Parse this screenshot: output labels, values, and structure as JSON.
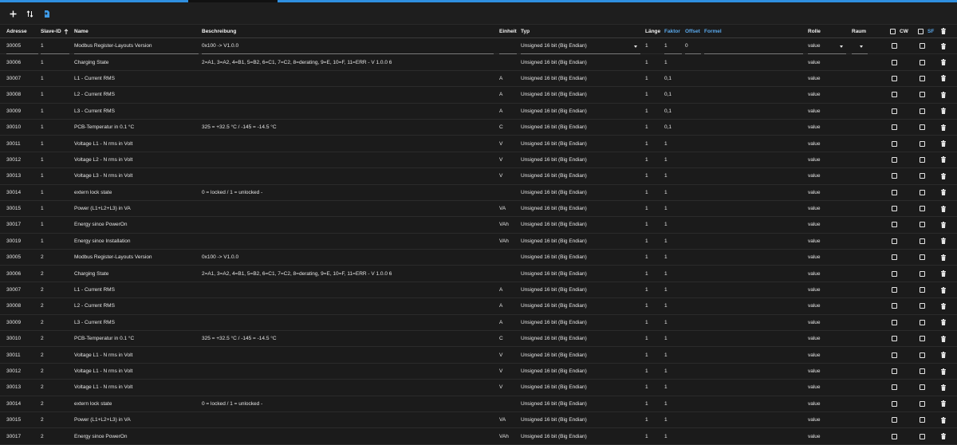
{
  "toolbar": {
    "add_icon": "plus-icon",
    "sort_icon": "sort-arrows-icon",
    "import_icon": "import-icon"
  },
  "columns": {
    "adresse": "Adresse",
    "slave": "Slave-ID",
    "name": "Name",
    "beschreibung": "Beschreibung",
    "einheit": "Einheit",
    "typ": "Typ",
    "laenge": "Länge",
    "faktor": "Faktor",
    "offset": "Offset",
    "formel": "Formel",
    "rolle": "Rolle",
    "raum": "Raum",
    "cw": "CW",
    "sf": "SF"
  },
  "rows": [
    {
      "addr": "30005",
      "slave": "1",
      "name": "Modbus Register-Layouts Version",
      "desc": "0x100 -> V1.0.0",
      "unit": "",
      "typ": "Unsigned 16 bit (Big Endian)",
      "len": "1",
      "fak": "1",
      "off": "0",
      "role": "value"
    },
    {
      "addr": "30006",
      "slave": "1",
      "name": "Charging State",
      "desc": "2=A1, 3=A2, 4=B1, 5=B2, 6=C1, 7=C2, 8=derating, 9=E, 10=F, 11=ERR - V 1.0.0 6",
      "unit": "",
      "typ": "Unsigned 16 bit (Big Endian)",
      "len": "1",
      "fak": "1",
      "off": "",
      "role": "value"
    },
    {
      "addr": "30007",
      "slave": "1",
      "name": "L1 - Current RMS",
      "desc": "",
      "unit": "A",
      "typ": "Unsigned 16 bit (Big Endian)",
      "len": "1",
      "fak": "0,1",
      "off": "",
      "role": "value"
    },
    {
      "addr": "30008",
      "slave": "1",
      "name": "L2 - Current RMS",
      "desc": "",
      "unit": "A",
      "typ": "Unsigned 16 bit (Big Endian)",
      "len": "1",
      "fak": "0,1",
      "off": "",
      "role": "value"
    },
    {
      "addr": "30009",
      "slave": "1",
      "name": "L3 - Current RMS",
      "desc": "",
      "unit": "A",
      "typ": "Unsigned 16 bit (Big Endian)",
      "len": "1",
      "fak": "0,1",
      "off": "",
      "role": "value"
    },
    {
      "addr": "30010",
      "slave": "1",
      "name": "PCB-Temperatur in 0.1 °C",
      "desc": "325 = +32.5 °C / -145 = -14.5 °C",
      "unit": "C",
      "typ": "Unsigned 16 bit (Big Endian)",
      "len": "1",
      "fak": "0,1",
      "off": "",
      "role": "value"
    },
    {
      "addr": "30011",
      "slave": "1",
      "name": "Voltage L1 - N rms in Volt",
      "desc": "",
      "unit": "V",
      "typ": "Unsigned 16 bit (Big Endian)",
      "len": "1",
      "fak": "1",
      "off": "",
      "role": "value"
    },
    {
      "addr": "30012",
      "slave": "1",
      "name": "Voltage L2 - N rms in Volt",
      "desc": "",
      "unit": "V",
      "typ": "Unsigned 16 bit (Big Endian)",
      "len": "1",
      "fak": "1",
      "off": "",
      "role": "value"
    },
    {
      "addr": "30013",
      "slave": "1",
      "name": "Voltage L3 - N rms in Volt",
      "desc": "",
      "unit": "V",
      "typ": "Unsigned 16 bit (Big Endian)",
      "len": "1",
      "fak": "1",
      "off": "",
      "role": "value"
    },
    {
      "addr": "30014",
      "slave": "1",
      "name": "extern lock state",
      "desc": "0 = locked / 1 = unlocked -",
      "unit": "",
      "typ": "Unsigned 16 bit (Big Endian)",
      "len": "1",
      "fak": "1",
      "off": "",
      "role": "value"
    },
    {
      "addr": "30015",
      "slave": "1",
      "name": "Power (L1+L2+L3) in VA",
      "desc": "",
      "unit": "VA",
      "typ": "Unsigned 16 bit (Big Endian)",
      "len": "1",
      "fak": "1",
      "off": "",
      "role": "value"
    },
    {
      "addr": "30017",
      "slave": "1",
      "name": "Energy since PowerOn",
      "desc": "",
      "unit": "VAh",
      "typ": "Unsigned 16 bit (Big Endian)",
      "len": "1",
      "fak": "1",
      "off": "",
      "role": "value"
    },
    {
      "addr": "30019",
      "slave": "1",
      "name": "Energy since Installation",
      "desc": "",
      "unit": "VAh",
      "typ": "Unsigned 16 bit (Big Endian)",
      "len": "1",
      "fak": "1",
      "off": "",
      "role": "value"
    },
    {
      "addr": "30005",
      "slave": "2",
      "name": "Modbus Register-Layouts Version",
      "desc": "0x100 -> V1.0.0",
      "unit": "",
      "typ": "Unsigned 16 bit (Big Endian)",
      "len": "1",
      "fak": "1",
      "off": "",
      "role": "value"
    },
    {
      "addr": "30006",
      "slave": "2",
      "name": "Charging State",
      "desc": "2=A1, 3=A2, 4=B1, 5=B2, 6=C1, 7=C2, 8=derating, 9=E, 10=F, 11=ERR - V 1.0.0 6",
      "unit": "",
      "typ": "Unsigned 16 bit (Big Endian)",
      "len": "1",
      "fak": "1",
      "off": "",
      "role": "value"
    },
    {
      "addr": "30007",
      "slave": "2",
      "name": "L1 - Current RMS",
      "desc": "",
      "unit": "A",
      "typ": "Unsigned 16 bit (Big Endian)",
      "len": "1",
      "fak": "1",
      "off": "",
      "role": "value"
    },
    {
      "addr": "30008",
      "slave": "2",
      "name": "L2 - Current RMS",
      "desc": "",
      "unit": "A",
      "typ": "Unsigned 16 bit (Big Endian)",
      "len": "1",
      "fak": "1",
      "off": "",
      "role": "value"
    },
    {
      "addr": "30009",
      "slave": "2",
      "name": "L3 - Current RMS",
      "desc": "",
      "unit": "A",
      "typ": "Unsigned 16 bit (Big Endian)",
      "len": "1",
      "fak": "1",
      "off": "",
      "role": "value"
    },
    {
      "addr": "30010",
      "slave": "2",
      "name": "PCB-Temperatur in 0.1 °C",
      "desc": "325 = +32.5 °C / -145 = -14.5 °C",
      "unit": "C",
      "typ": "Unsigned 16 bit (Big Endian)",
      "len": "1",
      "fak": "1",
      "off": "",
      "role": "value"
    },
    {
      "addr": "30011",
      "slave": "2",
      "name": "Voltage L1 - N rms in Volt",
      "desc": "",
      "unit": "V",
      "typ": "Unsigned 16 bit (Big Endian)",
      "len": "1",
      "fak": "1",
      "off": "",
      "role": "value"
    },
    {
      "addr": "30012",
      "slave": "2",
      "name": "Voltage L1 - N rms in Volt",
      "desc": "",
      "unit": "V",
      "typ": "Unsigned 16 bit (Big Endian)",
      "len": "1",
      "fak": "1",
      "off": "",
      "role": "value"
    },
    {
      "addr": "30013",
      "slave": "2",
      "name": "Voltage L1 - N rms in Volt",
      "desc": "",
      "unit": "V",
      "typ": "Unsigned 16 bit (Big Endian)",
      "len": "1",
      "fak": "1",
      "off": "",
      "role": "value"
    },
    {
      "addr": "30014",
      "slave": "2",
      "name": "extern lock state",
      "desc": "0 = locked / 1 = unlocked -",
      "unit": "",
      "typ": "Unsigned 16 bit (Big Endian)",
      "len": "1",
      "fak": "1",
      "off": "",
      "role": "value"
    },
    {
      "addr": "30015",
      "slave": "2",
      "name": "Power (L1+L2+L3) in VA",
      "desc": "",
      "unit": "VA",
      "typ": "Unsigned 16 bit (Big Endian)",
      "len": "1",
      "fak": "1",
      "off": "",
      "role": "value"
    },
    {
      "addr": "30017",
      "slave": "2",
      "name": "Energy since PowerOn",
      "desc": "",
      "unit": "VAh",
      "typ": "Unsigned 16 bit (Big Endian)",
      "len": "1",
      "fak": "1",
      "off": "",
      "role": "value"
    }
  ],
  "colors": {
    "accent": "#2f8fe0",
    "header_link": "#5aa9ec",
    "background": "#1b1b1b"
  }
}
